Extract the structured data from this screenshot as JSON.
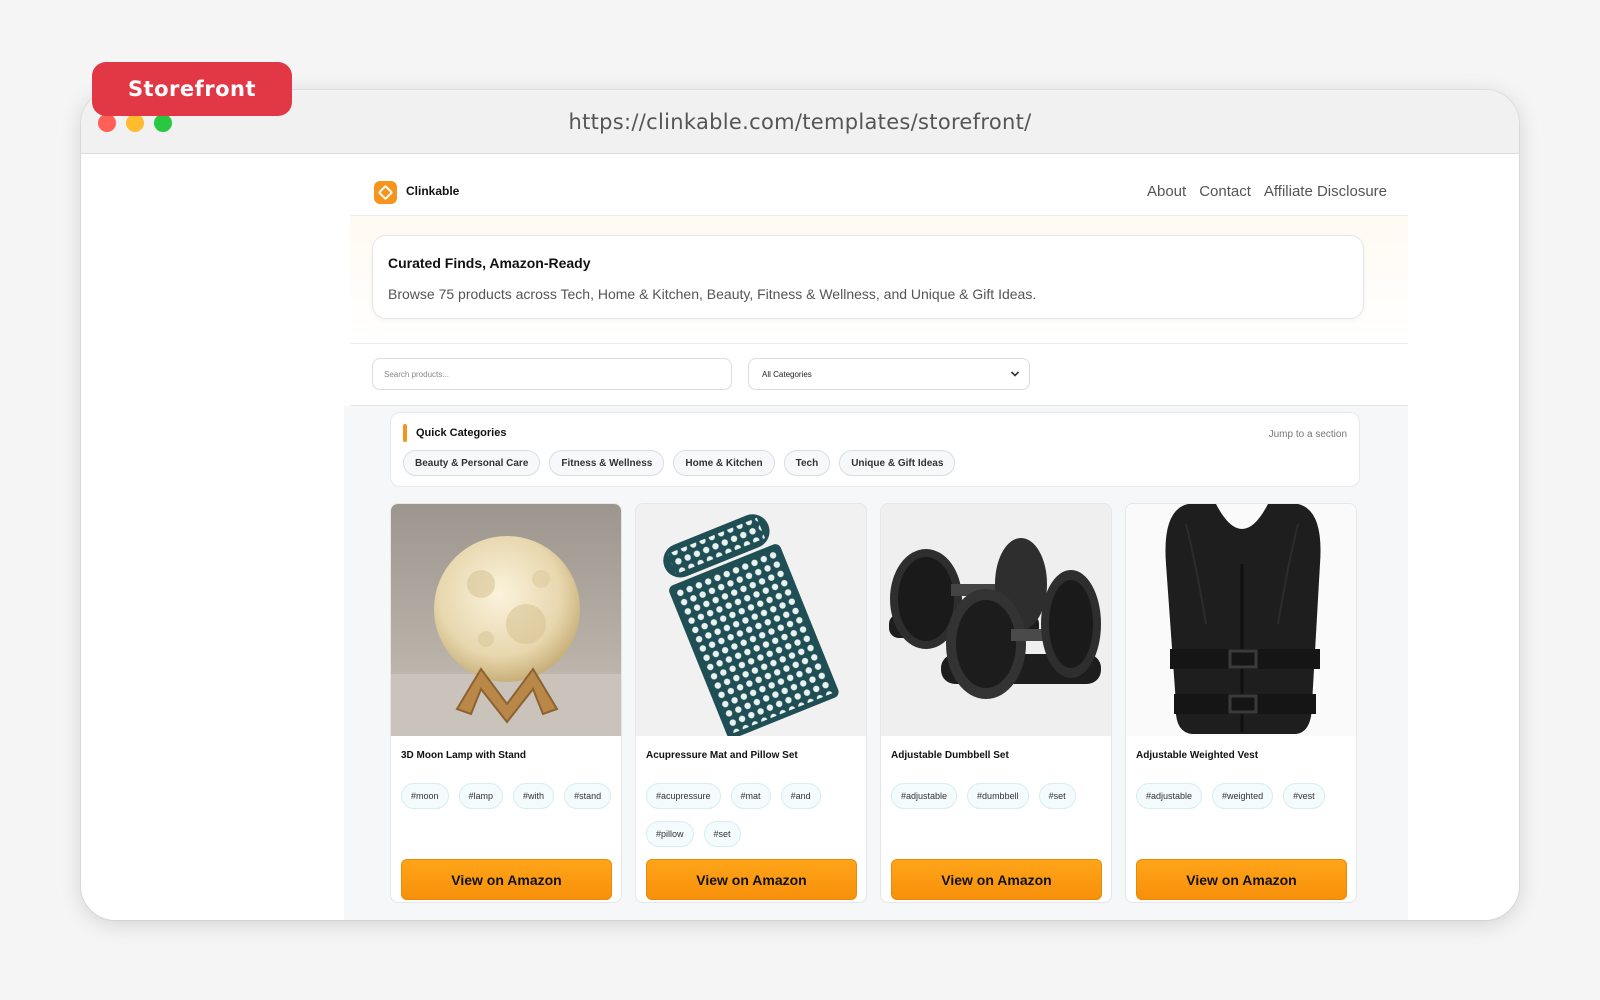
{
  "badge": "Storefront",
  "browser": {
    "url": "https://clinkable.com/templates/storefront/"
  },
  "nav": {
    "brand": "Clinkable",
    "links": [
      "About",
      "Contact",
      "Affiliate Disclosure"
    ]
  },
  "hero": {
    "title": "Curated Finds, Amazon-Ready",
    "subtitle": "Browse 75 products across Tech, Home & Kitchen, Beauty, Fitness & Wellness, and Unique & Gift Ideas."
  },
  "filters": {
    "search_placeholder": "Search products...",
    "category_selected": "All Categories"
  },
  "quick": {
    "title": "Quick Categories",
    "jump": "Jump to a section",
    "chips": [
      "Beauty & Personal Care",
      "Fitness & Wellness",
      "Home & Kitchen",
      "Tech",
      "Unique & Gift Ideas"
    ]
  },
  "products": [
    {
      "title": "3D Moon Lamp with Stand",
      "tags": [
        "#moon",
        "#lamp",
        "#with",
        "#stand"
      ],
      "button": "View on Amazon",
      "image_icon": "moon-lamp-image"
    },
    {
      "title": "Acupressure Mat and Pillow Set",
      "tags": [
        "#acupressure",
        "#mat",
        "#and",
        "#pillow",
        "#set"
      ],
      "button": "View on Amazon",
      "image_icon": "acupressure-mat-image"
    },
    {
      "title": "Adjustable Dumbbell Set",
      "tags": [
        "#adjustable",
        "#dumbbell",
        "#set"
      ],
      "button": "View on Amazon",
      "image_icon": "dumbbell-image"
    },
    {
      "title": "Adjustable Weighted Vest",
      "tags": [
        "#adjustable",
        "#weighted",
        "#vest"
      ],
      "button": "View on Amazon",
      "image_icon": "weighted-vest-image"
    }
  ],
  "colors": {
    "accent": "#f7941d",
    "badge": "#e23744",
    "button": "#ff9f14"
  }
}
